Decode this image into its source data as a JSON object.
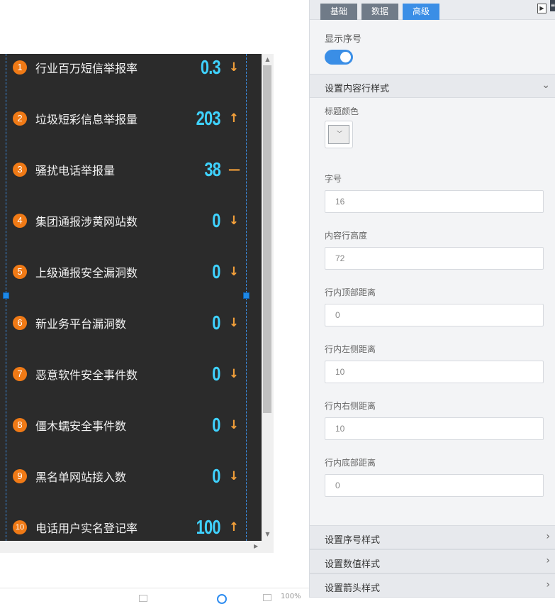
{
  "ranking": {
    "items": [
      {
        "rank": "1",
        "title": "行业百万短信举报率",
        "value": "0.3",
        "arrow": "↓"
      },
      {
        "rank": "2",
        "title": "垃圾短彩信息举报量",
        "value": "203",
        "arrow": "↑"
      },
      {
        "rank": "3",
        "title": "骚扰电话举报量",
        "value": "38",
        "arrow": "—"
      },
      {
        "rank": "4",
        "title": "集团通报涉黄网站数",
        "value": "0",
        "arrow": "↓"
      },
      {
        "rank": "5",
        "title": "上级通报安全漏洞数",
        "value": "0",
        "arrow": "↓"
      },
      {
        "rank": "6",
        "title": "新业务平台漏洞数",
        "value": "0",
        "arrow": "↓"
      },
      {
        "rank": "7",
        "title": "恶意软件安全事件数",
        "value": "0",
        "arrow": "↓"
      },
      {
        "rank": "8",
        "title": "僵木蠕安全事件数",
        "value": "0",
        "arrow": "↓"
      },
      {
        "rank": "9",
        "title": "黑名单网站接入数",
        "value": "0",
        "arrow": "↓"
      },
      {
        "rank": "10",
        "title": "电话用户实名登记率",
        "value": "100",
        "arrow": "↑"
      }
    ]
  },
  "canvas_footer": {
    "zoom_text": "100%"
  },
  "panel": {
    "tabs": [
      "基础",
      "数据",
      "高级"
    ],
    "active_tab": "高级",
    "show_index_label": "显示序号",
    "show_index_on": true,
    "section_content_style": "设置内容行样式",
    "title_color_label": "标题颜色",
    "fields": [
      {
        "label": "字号",
        "value": "16"
      },
      {
        "label": "内容行高度",
        "value": "72"
      },
      {
        "label": "行内顶部距离",
        "value": "0"
      },
      {
        "label": "行内左侧距离",
        "value": "10"
      },
      {
        "label": "行内右侧距离",
        "value": "10"
      },
      {
        "label": "行内底部距离",
        "value": "0"
      }
    ],
    "sections_bottom": [
      "设置序号样式",
      "设置数值样式",
      "设置箭头样式"
    ]
  },
  "colors": {
    "widget_bg": "#2b2b2b",
    "rank_badge": "#f07a16",
    "value_color": "#3fd2ff",
    "arrow_color": "#f5a13a",
    "accent": "#3a8ee6"
  }
}
